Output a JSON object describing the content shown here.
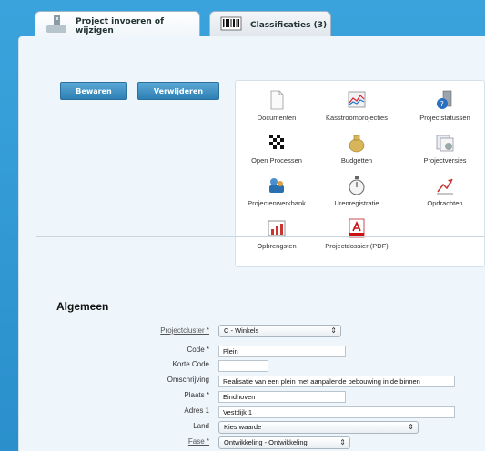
{
  "tabs": [
    {
      "label": "Project invoeren of wijzigen",
      "icon": "project-icon",
      "active": true
    },
    {
      "label": "Classificaties (3)",
      "icon": "barcode-icon",
      "active": false
    }
  ],
  "toolbar": {
    "save_label": "Bewaren",
    "delete_label": "Verwijderen"
  },
  "tiles": [
    {
      "label": "Documenten",
      "icon": "document-icon"
    },
    {
      "label": "Kasstroomprojecties",
      "icon": "cashflow-chart-icon"
    },
    {
      "label": "Projectstatussen",
      "icon": "status-icon"
    },
    {
      "label": "Open Processen",
      "icon": "checkered-flag-icon"
    },
    {
      "label": "Budgetten",
      "icon": "money-bag-icon"
    },
    {
      "label": "Projectversies",
      "icon": "versions-icon"
    },
    {
      "label": "Projectenwerkbank",
      "icon": "workbench-icon"
    },
    {
      "label": "Urenregistratie",
      "icon": "stopwatch-icon"
    },
    {
      "label": "Opdrachten",
      "icon": "chart-arrow-icon"
    },
    {
      "label": "Opbrengsten",
      "icon": "revenue-chart-icon"
    },
    {
      "label": "Projectdossier (PDF)",
      "icon": "pdf-icon"
    }
  ],
  "section": {
    "title": "Algemeen"
  },
  "form": {
    "projectcluster": {
      "label": "Projectcluster *",
      "value": "C - Winkels"
    },
    "code": {
      "label": "Code *",
      "value": "Plein"
    },
    "korte_code": {
      "label": "Korte Code",
      "value": ""
    },
    "omschrijving": {
      "label": "Omschrijving",
      "value": "Realisatie van een plein met aanpalende bebouwing in de binnen"
    },
    "plaats": {
      "label": "Plaats *",
      "value": "Eindhoven"
    },
    "adres": {
      "label": "Adres 1",
      "value": "Vestdijk 1"
    },
    "land": {
      "label": "Land",
      "value": "Kies waarde"
    },
    "fase": {
      "label": "Fase *",
      "value": "Ontwikkeling - Ontwikkeling"
    }
  },
  "colors": {
    "background": "#2f9ad3",
    "button": "#3a8bc0",
    "panel": "#eef5fb"
  }
}
